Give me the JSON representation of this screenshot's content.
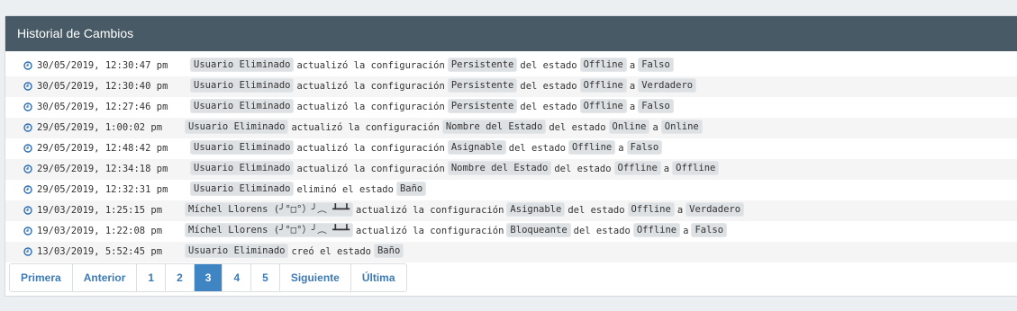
{
  "panel": {
    "title": "Historial de Cambios"
  },
  "rows": [
    {
      "date": "30/05/2019, 12:30:47 pm",
      "user": "Usuario Eliminado",
      "action": "actualizó la configuración",
      "setting": "Persistente",
      "middle": "del estado",
      "state": "Offline",
      "conj": "a",
      "value": "Falso"
    },
    {
      "date": "30/05/2019, 12:30:40 pm",
      "user": "Usuario Eliminado",
      "action": "actualizó la configuración",
      "setting": "Persistente",
      "middle": "del estado",
      "state": "Offline",
      "conj": "a",
      "value": "Verdadero"
    },
    {
      "date": "30/05/2019, 12:27:46 pm",
      "user": "Usuario Eliminado",
      "action": "actualizó la configuración",
      "setting": "Persistente",
      "middle": "del estado",
      "state": "Offline",
      "conj": "a",
      "value": "Falso"
    },
    {
      "date": "29/05/2019, 1:00:02 pm",
      "user": "Usuario Eliminado",
      "action": "actualizó la configuración",
      "setting": "Nombre del Estado",
      "middle": "del estado",
      "state": "Online",
      "conj": "a",
      "value": "Online"
    },
    {
      "date": "29/05/2019, 12:48:42 pm",
      "user": "Usuario Eliminado",
      "action": "actualizó la configuración",
      "setting": "Asignable",
      "middle": "del estado",
      "state": "Offline",
      "conj": "a",
      "value": "Falso"
    },
    {
      "date": "29/05/2019, 12:34:18 pm",
      "user": "Usuario Eliminado",
      "action": "actualizó la configuración",
      "setting": "Nombre del Estado",
      "middle": "del estado",
      "state": "Offline",
      "conj": "a",
      "value": "Offline"
    },
    {
      "date": "29/05/2019, 12:32:31 pm",
      "user": "Usuario Eliminado",
      "action": "eliminó el estado",
      "state": "Baño"
    },
    {
      "date": "19/03/2019, 1:25:15 pm",
      "user": "Míchel Llorens (╯°□°）╯︵ ┻━┻",
      "action": "actualizó la configuración",
      "setting": "Asignable",
      "middle": "del estado",
      "state": "Offline",
      "conj": "a",
      "value": "Verdadero"
    },
    {
      "date": "19/03/2019, 1:22:08 pm",
      "user": "Míchel Llorens (╯°□°）╯︵ ┻━┻",
      "action": "actualizó la configuración",
      "setting": "Bloqueante",
      "middle": "del estado",
      "state": "Offline",
      "conj": "a",
      "value": "Falso"
    },
    {
      "date": "13/03/2019, 5:52:45 pm",
      "user": "Usuario Eliminado",
      "action": "creó el estado",
      "state": "Baño"
    }
  ],
  "pagination": {
    "items": [
      "Primera",
      "Anterior",
      "1",
      "2",
      "3",
      "4",
      "5",
      "Siguiente",
      "Última"
    ],
    "active": "3"
  },
  "colors": {
    "header_bg": "#475a66",
    "accent": "#3f85c4",
    "clock_icon": "#2a6db5"
  }
}
